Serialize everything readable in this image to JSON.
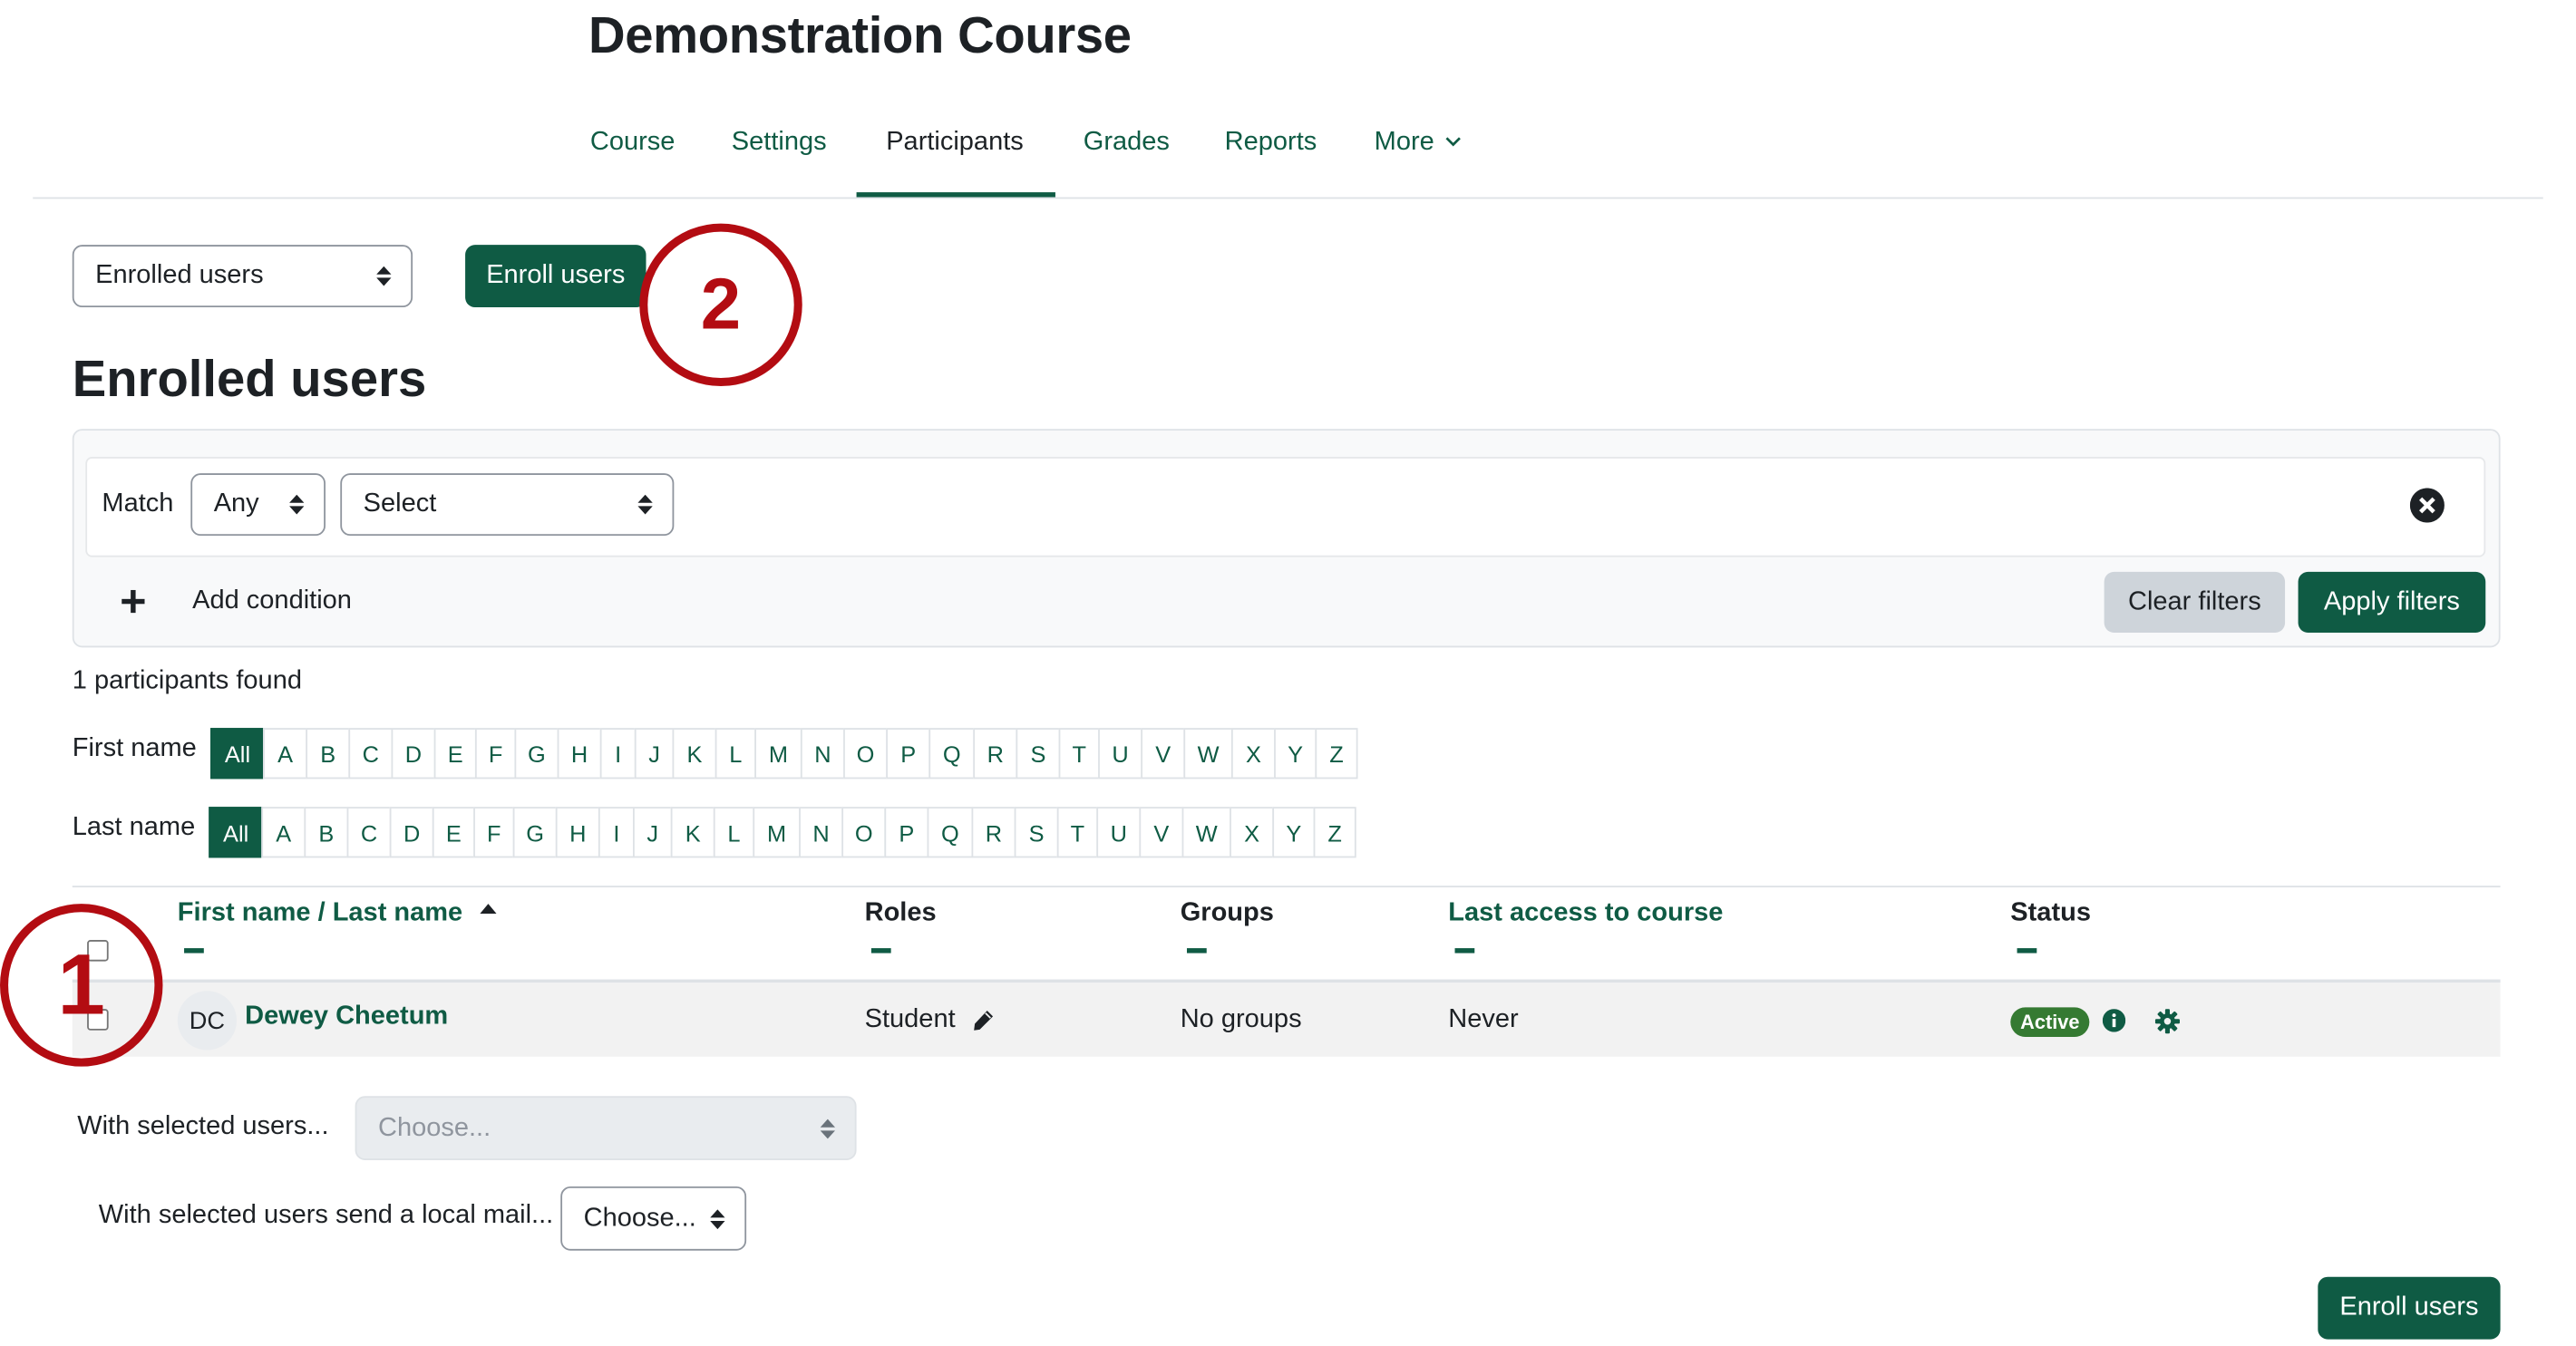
{
  "page": {
    "course_title": "Demonstration Course"
  },
  "nav": {
    "tabs": [
      {
        "label": "Course"
      },
      {
        "label": "Settings"
      },
      {
        "label": "Participants",
        "active": true
      },
      {
        "label": "Grades"
      },
      {
        "label": "Reports"
      },
      {
        "label": "More"
      }
    ]
  },
  "toolbar": {
    "view_select": "Enrolled users",
    "enroll_button": "Enroll users"
  },
  "callouts": {
    "one": "1",
    "two": "2",
    "color": "#b30c12"
  },
  "main": {
    "heading": "Enrolled users"
  },
  "filters": {
    "match_label": "Match",
    "match_value": "Any",
    "condition_value": "Select",
    "add_condition": "Add condition",
    "clear_button": "Clear filters",
    "apply_button": "Apply filters"
  },
  "results": {
    "count_text": "1 participants found"
  },
  "initials_bar": {
    "first_name_label": "First name",
    "last_name_label": "Last name",
    "all_label": "All",
    "letters": [
      "A",
      "B",
      "C",
      "D",
      "E",
      "F",
      "G",
      "H",
      "I",
      "J",
      "K",
      "L",
      "M",
      "N",
      "O",
      "P",
      "Q",
      "R",
      "S",
      "T",
      "U",
      "V",
      "W",
      "X",
      "Y",
      "Z"
    ]
  },
  "table": {
    "columns": {
      "first_name": "First name",
      "separator": " / ",
      "last_name": "Last name",
      "roles": "Roles",
      "groups": "Groups",
      "last_access": "Last access to course",
      "status": "Status"
    },
    "sort_indicator": "ascending",
    "rows": [
      {
        "initials": "DC",
        "name": "Dewey Cheetum",
        "role": "Student",
        "groups": "No groups",
        "last_access": "Never",
        "status": "Active"
      }
    ]
  },
  "bulk": {
    "with_selected_label": "With selected users...",
    "with_selected_placeholder": "Choose...",
    "local_mail_label": "With selected users send a local mail...",
    "local_mail_value": "Choose..."
  },
  "footer": {
    "enroll_button": "Enroll users"
  },
  "colors": {
    "brand": "#0f5b44",
    "status_active": "#357a32"
  },
  "icons": [
    "chevron-down-icon",
    "sort-arrows-icon",
    "clear-icon",
    "plus-icon",
    "sort-up-icon",
    "pencil-icon",
    "info-icon",
    "gear-icon"
  ]
}
